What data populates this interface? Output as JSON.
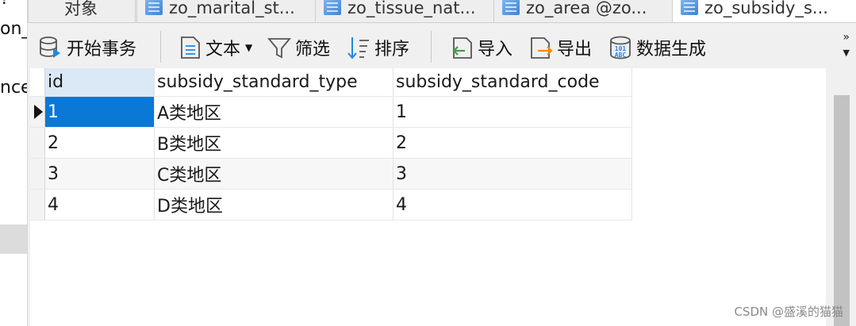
{
  "left_panel": {
    "items": [
      {
        "text": "?"
      },
      {
        "text": "on_s"
      },
      {
        "text": "nce_"
      }
    ]
  },
  "tabs": [
    {
      "label": "对象"
    },
    {
      "label": "zo_marital_st..."
    },
    {
      "label": "zo_tissue_nat..."
    },
    {
      "label": "zo_area @zo..."
    },
    {
      "label": "zo_subsidy_s..."
    }
  ],
  "toolbar": {
    "begin_transaction": "开始事务",
    "text": "文本",
    "filter": "筛选",
    "sort": "排序",
    "import": "导入",
    "export": "导出",
    "generate_data": "数据生成",
    "overflow_icon": "double-chevron-right-icon"
  },
  "grid": {
    "columns": [
      "id",
      "subsidy_standard_type",
      "subsidy_standard_code"
    ],
    "rows": [
      [
        "1",
        "A类地区",
        "1"
      ],
      [
        "2",
        "B类地区",
        "2"
      ],
      [
        "3",
        "C类地区",
        "3"
      ],
      [
        "4",
        "D类地区",
        "4"
      ]
    ]
  },
  "watermark": "CSDN @盛溪的猫猫",
  "colors": {
    "selection": "#0a78d7",
    "header_highlight": "#dbe8f6",
    "tab_icon": "#3c84d6"
  }
}
